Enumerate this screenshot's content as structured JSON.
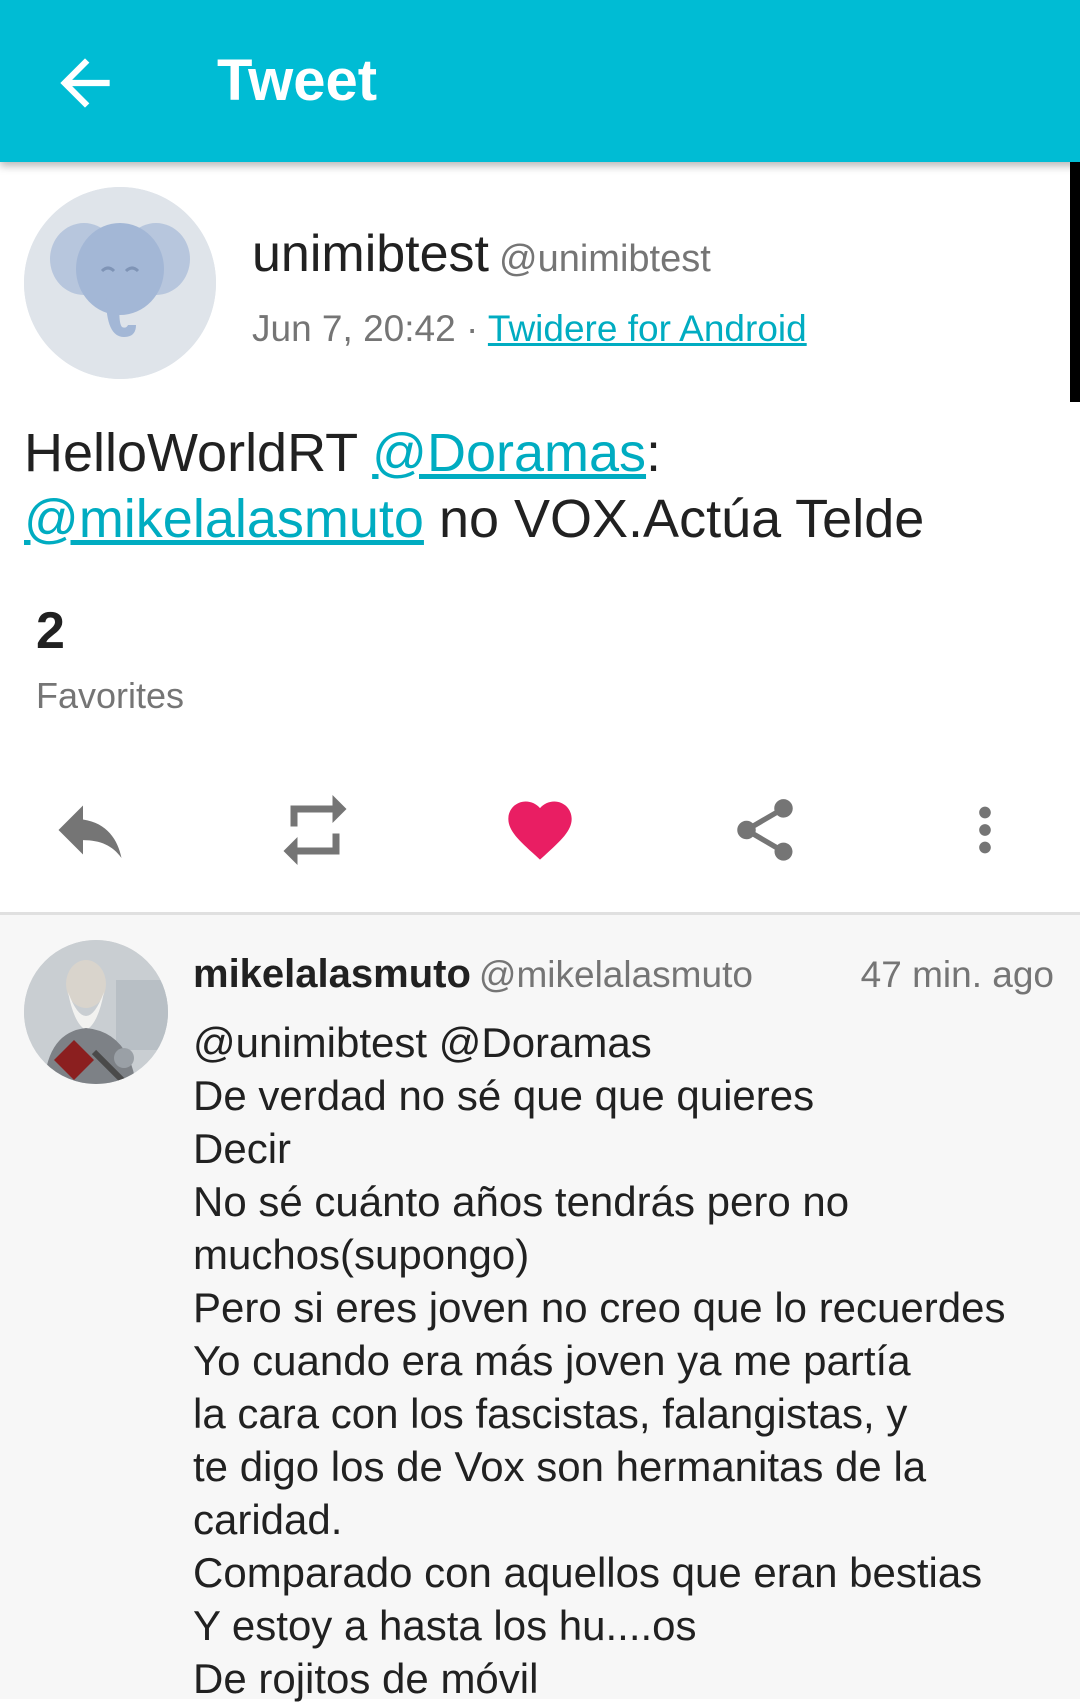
{
  "appbar": {
    "title": "Tweet",
    "back_icon": "arrow-back-icon",
    "background": "#00bcd4"
  },
  "tweet": {
    "display_name": "unimibtest",
    "handle": "@unimibtest",
    "date": "Jun 7, 20:42",
    "separator": "·",
    "source": "Twidere for Android",
    "text_part1": "HelloWorldRT ",
    "mention1": "@Doramas",
    "text_part2": ":",
    "mention2": "@mikelalasmuto",
    "text_part3": " no VOX.Actúa Telde",
    "favorites_count": "2",
    "favorites_label": "Favorites",
    "link_color": "#00acc1"
  },
  "actions": [
    {
      "icon": "reply-icon"
    },
    {
      "icon": "retweet-icon"
    },
    {
      "icon": "heart-icon",
      "active": true,
      "color": "#e91e63"
    },
    {
      "icon": "share-icon"
    },
    {
      "icon": "more-vert-icon"
    }
  ],
  "reply": {
    "display_name": "mikelalasmuto",
    "handle": "@mikelalasmuto",
    "time": "47 min. ago",
    "text": "@unimibtest @Doramas\nDe verdad no sé que que quieres\nDecir\nNo sé cuánto años tendrás pero no muchos(supongo)\nPero si eres joven no creo que lo recuerdes\nYo cuando era más joven ya me partía\nla cara con los fascistas, falangistas, y\nte digo los de Vox son hermanitas de la caridad.\nComparado con aquellos que eran bestias\nY estoy a hasta los hu....os\nDe rojitos de móvil"
  }
}
